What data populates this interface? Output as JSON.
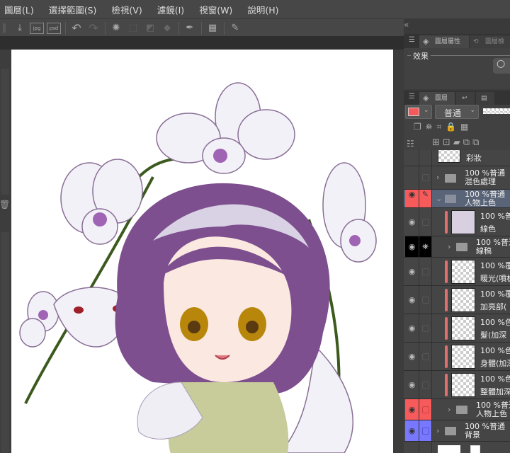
{
  "menu": [
    "圖層(L)",
    "選擇範圍(S)",
    "檢視(V)",
    "濾鏡(I)",
    "視窗(W)",
    "說明(H)"
  ],
  "toolbar": {
    "jpg": "jpg",
    "psd": "psd"
  },
  "colors": {
    "accent_red": "#f75a5a",
    "accent_blue": "#7878ff",
    "selected": "#5a6478"
  },
  "panel_top": {
    "collapse": "«",
    "tabs": [
      "圖層屬性",
      "圖層檢"
    ],
    "effect_label": "效果"
  },
  "layer_panel": {
    "tabs": [
      "圖層"
    ],
    "blend_mode": "普通",
    "layers": [
      {
        "meta": "",
        "name": "彩妝"
      },
      {
        "meta": "100 %普通",
        "name": "混色處理"
      },
      {
        "meta": "100 %普通",
        "name": "人物上色"
      },
      {
        "meta": "100 %普",
        "name": "線色"
      },
      {
        "meta": "100 %普通",
        "name": "線稿"
      },
      {
        "meta": "100 %覆",
        "name": "暖光(噴槍"
      },
      {
        "meta": "100 %覆",
        "name": "加亮部("
      },
      {
        "meta": "100 %色",
        "name": "髮(加深"
      },
      {
        "meta": "100 %色",
        "name": "身體(加深"
      },
      {
        "meta": "100 %色",
        "name": "整體加深"
      },
      {
        "meta": "100 %普通",
        "name": "人物上色"
      },
      {
        "meta": "100 %普通",
        "name": "背景"
      }
    ]
  }
}
